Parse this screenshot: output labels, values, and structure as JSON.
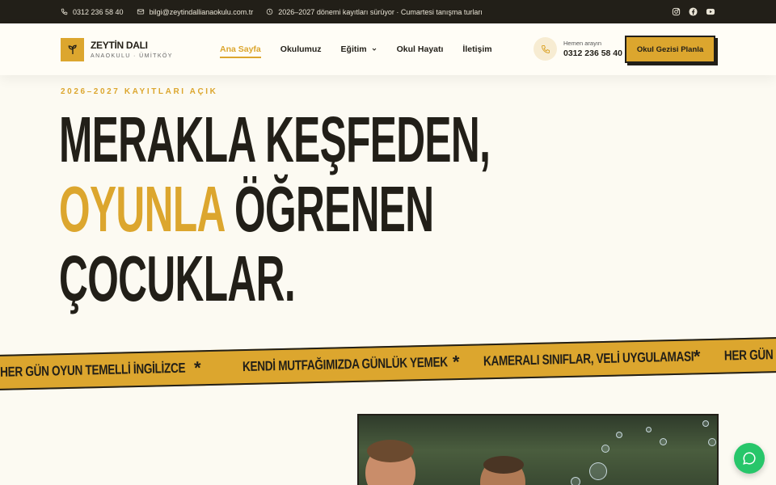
{
  "topbar": {
    "phone": "0312 236 58 40",
    "email": "bilgi@zeytindallianaokulu.com.tr",
    "notice": "2026–2027 dönemi kayıtları sürüyor · Cumartesi tanışma turları",
    "social": [
      "instagram-icon",
      "facebook-icon",
      "youtube-icon"
    ]
  },
  "brand": {
    "name": "ZEYTİN DALI",
    "subtitle": "ANAOKULU · ÜMİTKÖY"
  },
  "nav": {
    "items": [
      {
        "label": "Ana Sayfa",
        "active": true
      },
      {
        "label": "Okulumuz",
        "active": false
      },
      {
        "label": "Eğitim",
        "active": false,
        "dropdown": true
      },
      {
        "label": "Okul Hayatı",
        "active": false
      },
      {
        "label": "İletişim",
        "active": false
      }
    ]
  },
  "call": {
    "caption": "Hemen arayın",
    "number": "0312 236 58 40"
  },
  "cta": {
    "label": "Okul Gezisi Planla"
  },
  "hero": {
    "eyebrow": "2026–2027 KAYITLARI AÇIK",
    "line1": "MERAKLA KEŞFEDEN,",
    "line2_highlight": "OYUNLA",
    "line2_rest": " ÖĞRENEN",
    "line3": "ÇOCUKLAR."
  },
  "ribbon": {
    "items": [
      "HER GÜN OYUN TEMELLİ İNGİLİZCE",
      "KENDİ MUTFAĞIMIZDA GÜNLÜK YEMEK",
      "KAMERALI SINIFLAR, VELİ UYGULAMASI",
      "HER GÜN OYUN TEMELLİ İNGİLİZCE"
    ],
    "separator": "*"
  },
  "colors": {
    "accent": "#dca62e",
    "dark": "#221f18",
    "background": "#fcfaf2",
    "chat": "#27c66a"
  }
}
